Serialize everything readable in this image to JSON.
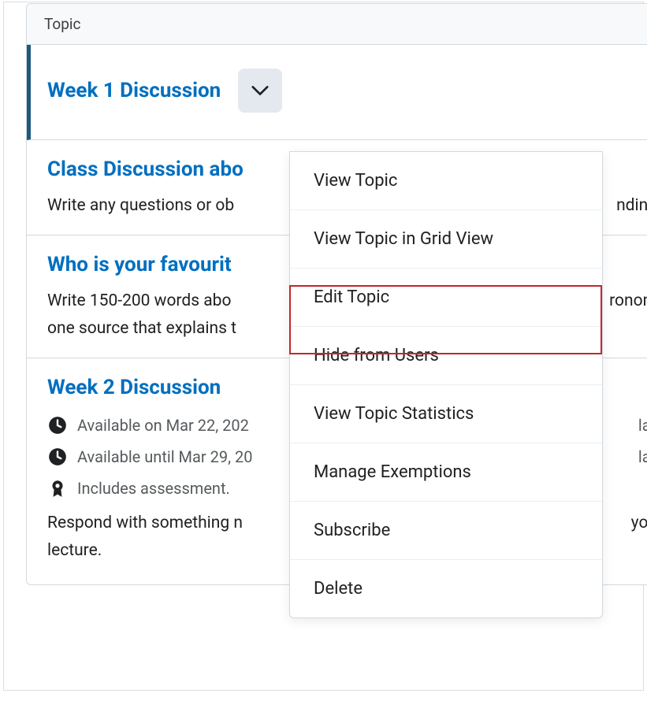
{
  "panel": {
    "header": "Topic"
  },
  "topics": [
    {
      "title": "Week 1 Discussion",
      "selected": true
    },
    {
      "title": "Class Discussion abo",
      "desc": "Write any questions or ob",
      "desc_tail": "nding",
      "hasCheck": true
    },
    {
      "title": "Who is your favourit",
      "desc": "Write 150-200 words abo",
      "desc_tail": "ronom",
      "desc2": "one source that explains t"
    },
    {
      "title": "Week 2 Discussion",
      "meta1": "Available on Mar 22, 202",
      "meta1_tail": "labilit",
      "meta2": "Available until Mar 29, 20",
      "meta2_tail": "labilit",
      "meta3": "Includes assessment.",
      "desc": "Respond with something n",
      "desc_tail": "you",
      "desc2": "lecture."
    }
  ],
  "menu": {
    "items": [
      "View Topic",
      "View Topic in Grid View",
      "Edit Topic",
      "Hide from Users",
      "View Topic Statistics",
      "Manage Exemptions",
      "Subscribe",
      "Delete"
    ]
  }
}
